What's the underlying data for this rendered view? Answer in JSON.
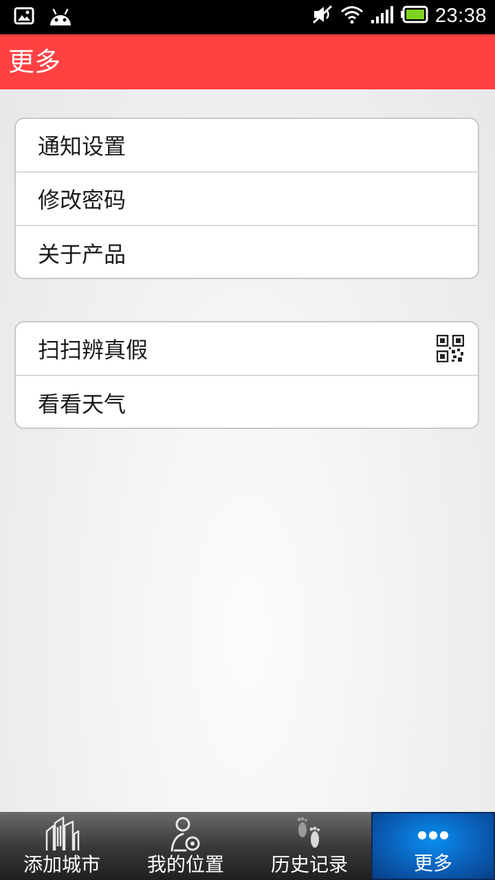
{
  "status_bar": {
    "time": "23:38",
    "icons": [
      "image-icon",
      "android-icon",
      "mute-icon",
      "wifi-icon",
      "signal-icon",
      "battery-icon"
    ]
  },
  "app_bar": {
    "title": "更多"
  },
  "menu_groups": [
    {
      "items": [
        {
          "label": "通知设置"
        },
        {
          "label": "修改密码"
        },
        {
          "label": "关于产品"
        }
      ]
    },
    {
      "items": [
        {
          "label": "扫扫辨真假",
          "icon": "qr-code-icon"
        },
        {
          "label": "看看天气"
        }
      ]
    }
  ],
  "tab_bar": {
    "tabs": [
      {
        "label": "添加城市",
        "icon": "city-icon"
      },
      {
        "label": "我的位置",
        "icon": "location-person-icon"
      },
      {
        "label": "历史记录",
        "icon": "footprints-icon"
      },
      {
        "label": "更多",
        "icon": "more-dots-icon",
        "active": true
      }
    ]
  },
  "colors": {
    "app_bar": "#ff4142",
    "active_tab": "#0a70d4"
  }
}
